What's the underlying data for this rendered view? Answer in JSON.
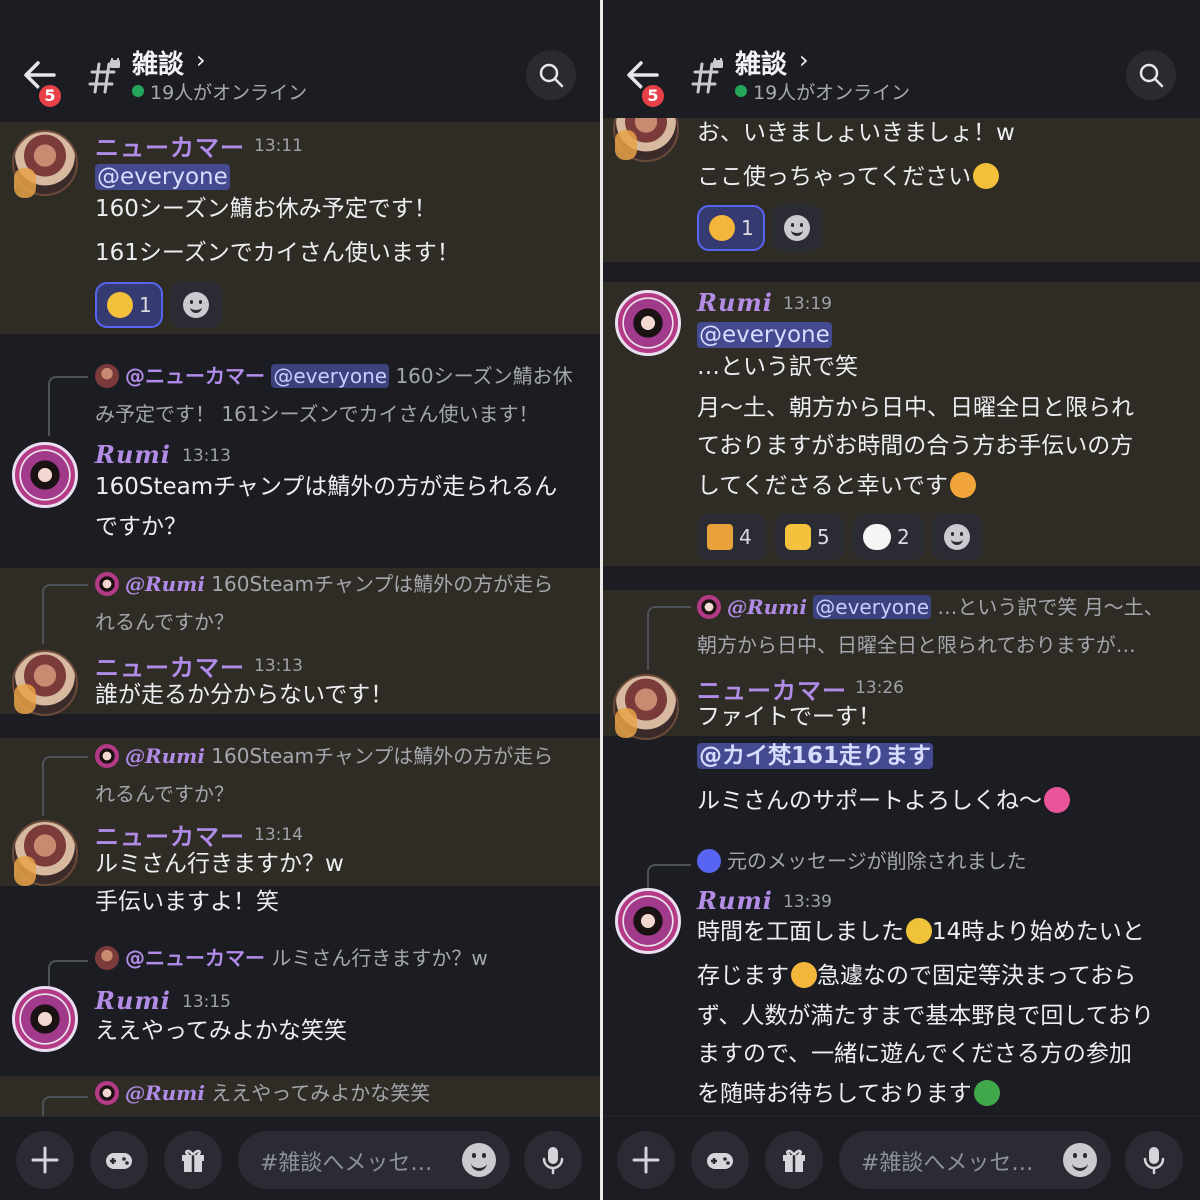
{
  "header": {
    "channel_name": "雑談",
    "chevron": "›",
    "online_text": "19人がオンライン",
    "notification_count": "5"
  },
  "left": {
    "msg1": {
      "author": "ニューカマー",
      "time": "13:11",
      "mention": "@everyone",
      "lines": [
        "160シーズン鯖お休み予定です！",
        "161シーズンでカイさん使います！"
      ],
      "reactions": [
        {
          "emoji": "pensive-face",
          "count": "1"
        }
      ]
    },
    "msg2": {
      "reply_author": "@ニューカマー",
      "reply_mention": "@everyone",
      "reply_line1": "160シーズン鯖お休",
      "reply_line2": "み予定です！ 161シーズンでカイさん使います！",
      "author": "Rumi",
      "time": "13:13",
      "lines": [
        "160Steamチャンプは鯖外の方が走られるん",
        "ですか？"
      ]
    },
    "msg3": {
      "reply_author": "@Rumi",
      "reply_line1": "160Steamチャンプは鯖外の方が走ら",
      "reply_line2": "れるんですか？",
      "author": "ニューカマー",
      "time": "13:13",
      "lines": [
        "誰が走るか分からないです！"
      ]
    },
    "msg4": {
      "reply_author": "@Rumi",
      "reply_line1": "160Steamチャンプは鯖外の方が走ら",
      "reply_line2": "れるんですか？",
      "author": "ニューカマー",
      "time": "13:14",
      "lines": [
        "ルミさん行きますか？w",
        "手伝いますよ！笑"
      ]
    },
    "msg5": {
      "reply_author": "@ニューカマー",
      "reply_line1": "ルミさん行きますか？w",
      "author": "Rumi",
      "time": "13:15",
      "lines": [
        "ええやってみよかな笑笑"
      ]
    },
    "msg6": {
      "reply_author": "@Rumi",
      "reply_line1": "ええやってみよかな笑笑"
    }
  },
  "right": {
    "msg1": {
      "lines": [
        "お、いきましょいきましょ！w",
        "ここ使っちゃってください"
      ],
      "reactions": [
        {
          "emoji": "person-bowing",
          "count": "1"
        }
      ]
    },
    "msg2": {
      "author": "Rumi",
      "time": "13:19",
      "mention": "@everyone",
      "lines": [
        "…という訳で笑",
        "月〜土、朝方から日中、日曜全日と限られ",
        "ておりますがお時間の合う方お手伝いの方",
        "してくださると幸いです"
      ],
      "reactions": [
        {
          "emoji": "party-popper",
          "count": "4"
        },
        {
          "emoji": "thumbs-up",
          "count": "5"
        },
        {
          "emoji": "eyes",
          "count": "2"
        }
      ]
    },
    "msg3": {
      "reply_author": "@Rumi",
      "reply_mention": "@everyone",
      "reply_line1": "…という訳で笑 月〜土、",
      "reply_line2": "朝方から日中、日曜全日と限られておりますが…",
      "author": "ニューカマー",
      "time": "13:26",
      "lines": [
        "ファイトでーす！",
        "@カイ梵161走ります",
        "ルミさんのサポートよろしくね〜"
      ]
    },
    "msg4": {
      "reply_text": "元のメッセージが削除されました",
      "author": "Rumi",
      "time": "13:39",
      "lines": [
        "時間を工面しました",
        "14時より始めたいと",
        "存じます",
        "急遽なので固定等決まっておら",
        "ず、人数が満たすまで基本野良で回しており",
        "ますので、一緒に遊んでくださる方の参加",
        "を随時お待ちしております"
      ]
    }
  },
  "input": {
    "placeholder": "#雑談へメッセ…"
  },
  "colors": {
    "accent": "#5865f2",
    "online": "#23a55a",
    "badge": "#e84047",
    "name": "#b18be8",
    "highlight": "#2f2c25"
  }
}
